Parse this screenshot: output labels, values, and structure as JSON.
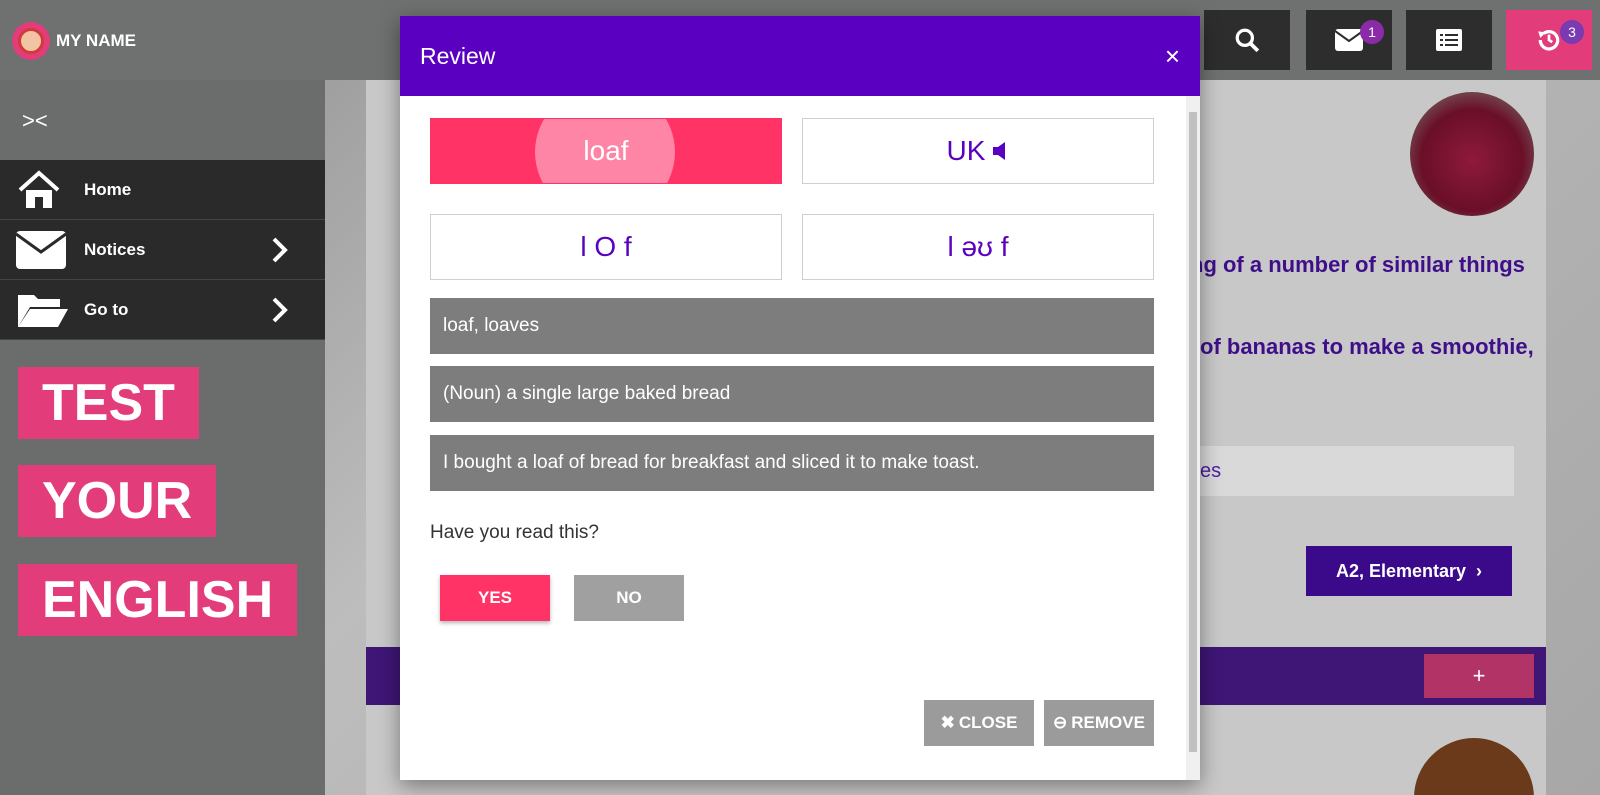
{
  "header": {
    "user_name": "MY NAME",
    "mail_badge": "1",
    "history_badge": "3"
  },
  "sidebar": {
    "items": [
      {
        "label": "Home"
      },
      {
        "label": "Notices"
      },
      {
        "label": "Go to"
      }
    ],
    "promo": [
      "TEST",
      "YOUR",
      "ENGLISH"
    ]
  },
  "background": {
    "text_line1": "ng of a number of similar things",
    "text_line2": "of bananas to make a smoothie,",
    "input_fragment": "es",
    "level_label": "A2, Elementary",
    "plus_label": "+"
  },
  "modal": {
    "title": "Review",
    "close_symbol": "×",
    "word": "loaf",
    "uk_label": "UK",
    "ipa_1": "l O f",
    "ipa_2": "l əʊ f",
    "forms": "loaf, loaves",
    "definition": "(Noun) a single large baked bread",
    "example": "I bought a loaf of bread for breakfast and sliced it to make toast.",
    "question": "Have you read this?",
    "yes_label": "YES",
    "no_label": "NO",
    "close_label": "CLOSE",
    "remove_label": "REMOVE"
  },
  "colors": {
    "modal_header": "#5a00c0",
    "accent_pink": "#ff3366",
    "promo_pink": "#e23c7a"
  }
}
